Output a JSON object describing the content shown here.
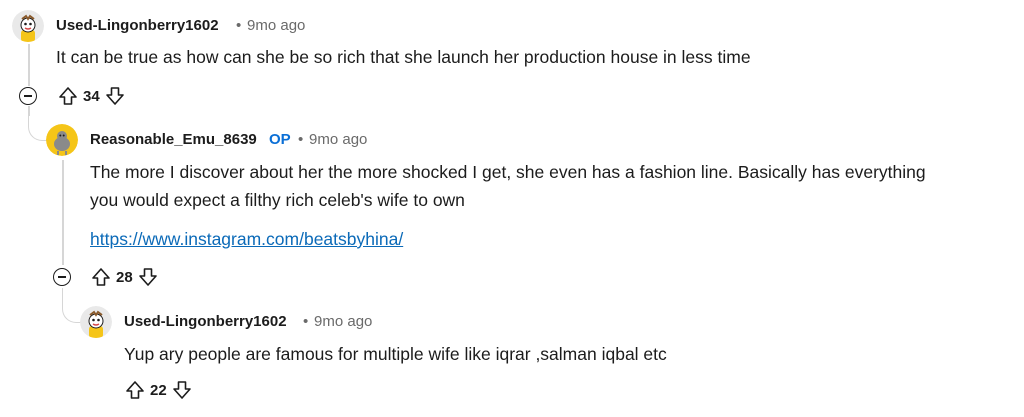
{
  "comments": [
    {
      "username": "Used-Lingonberry1602",
      "time": "9mo ago",
      "text": "It can be true as how can she be so rich that she launch her production house in less time",
      "votes": "34"
    },
    {
      "username": "Reasonable_Emu_8639",
      "op_badge": "OP",
      "time": "9mo ago",
      "text_line1": "The more I discover about her the more shocked I get, she even has a fashion line. Basically has everything",
      "text_line2": "you would expect a filthy rich celeb's wife to own",
      "link": "https://www.instagram.com/beatsbyhina/",
      "votes": "28"
    },
    {
      "username": "Used-Lingonberry1602",
      "time": "9mo ago",
      "text": "Yup ary people are famous for multiple wife like iqrar ,salman iqbal etc",
      "votes": "22"
    }
  ],
  "separator": "•",
  "colors": {
    "text": "#1c1c1c",
    "meta": "#6a6a6a",
    "op": "#0a6fd6",
    "link": "#0b6ab8",
    "thread": "#d6d6d6",
    "avatar_yellow": "#f5c518"
  }
}
